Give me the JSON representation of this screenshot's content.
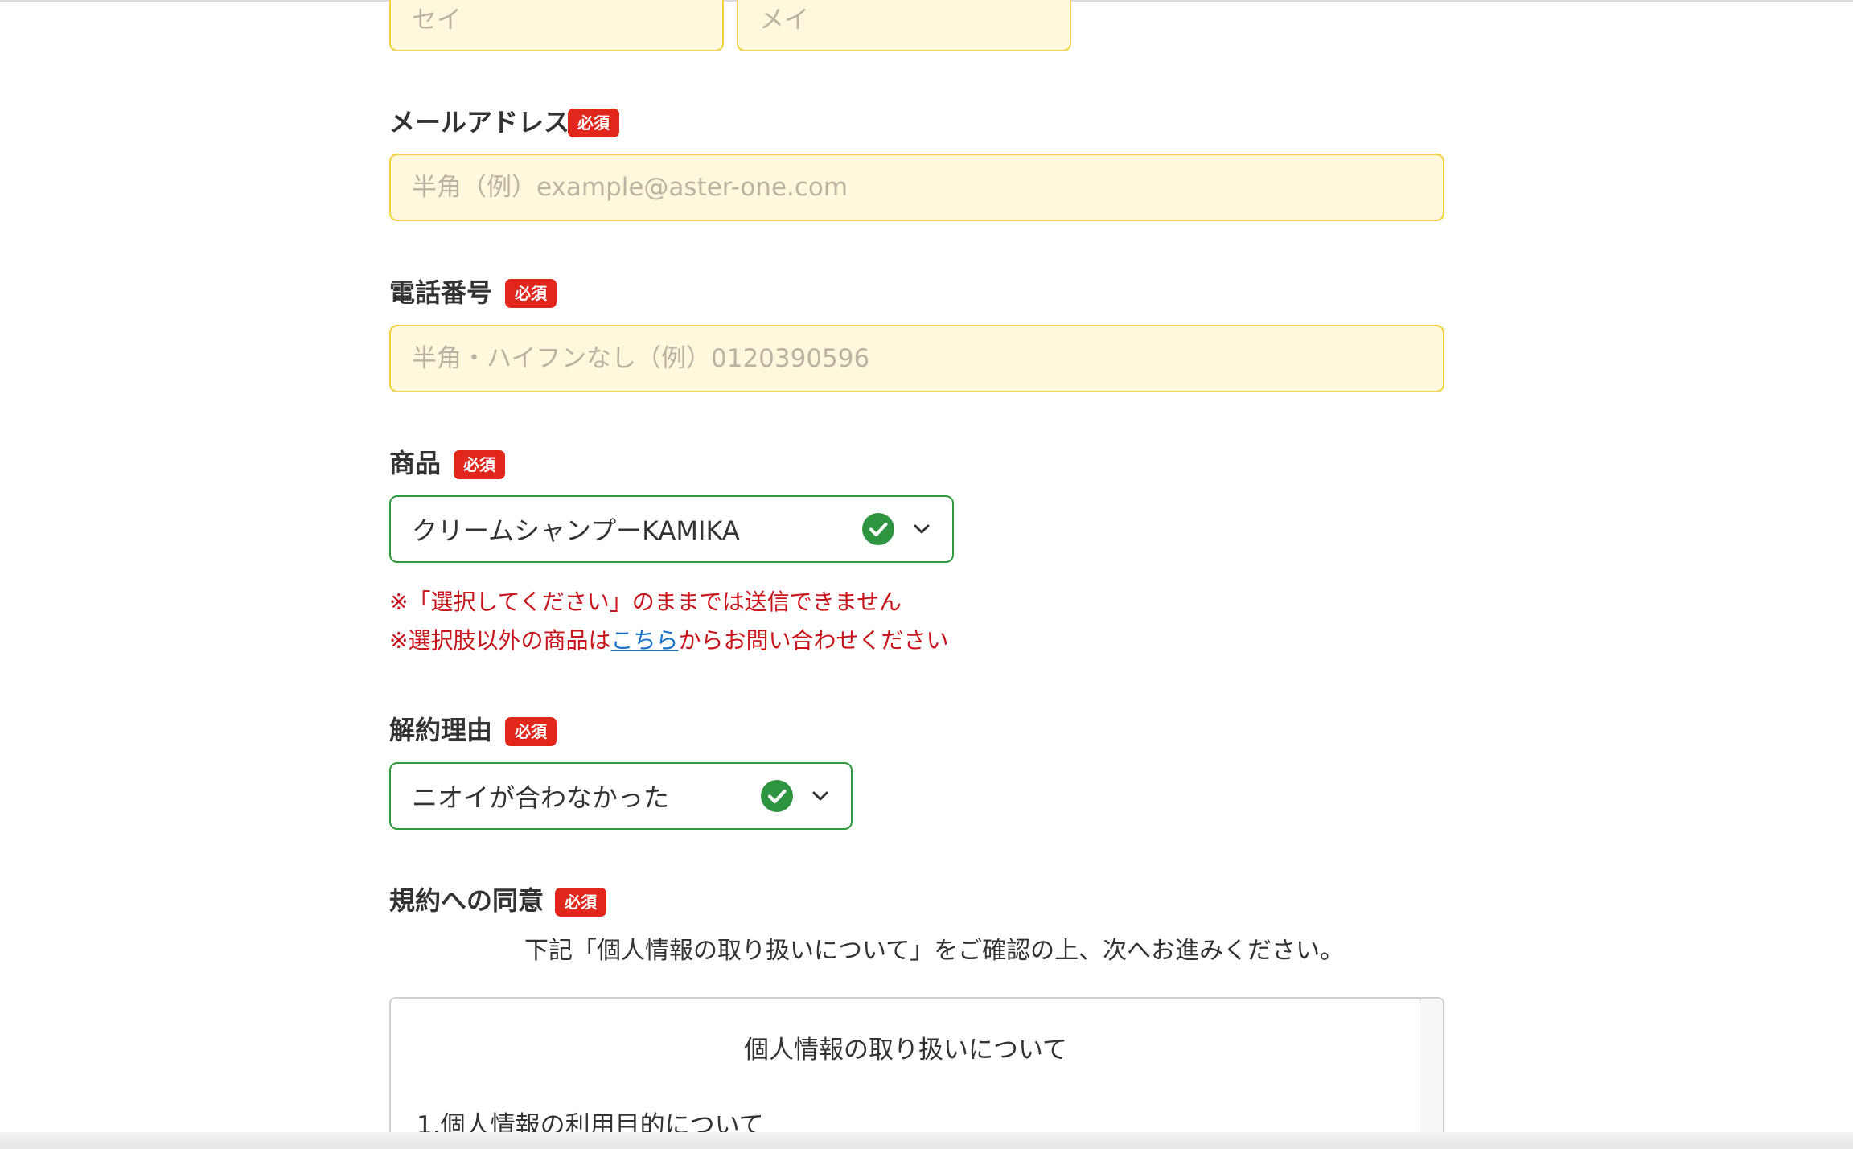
{
  "form": {
    "kana": {
      "sei_placeholder": "セイ",
      "mei_placeholder": "メイ"
    },
    "required_badge": "必須",
    "email": {
      "label": "メールアドレス",
      "placeholder": "半角（例）example@aster-one.com"
    },
    "phone": {
      "label": "電話番号",
      "placeholder": "半角・ハイフンなし（例）0120390596"
    },
    "product": {
      "label": "商品",
      "selected_value": "クリームシャンプーKAMIKA",
      "note1": "※「選択してください」のままでは送信できません",
      "note2_before": "※選択肢以外の商品は",
      "note2_link": "こちら",
      "note2_after": "からお問い合わせください"
    },
    "reason": {
      "label": "解約理由",
      "selected_value": "ニオイが合わなかった"
    },
    "terms": {
      "label": "規約への同意",
      "lead": "下記「個人情報の取り扱いについて」をご確認の上、次へお進みください。",
      "box_title": "個人情報の取り扱いについて",
      "box_item1": "1.個人情報の利用目的について"
    }
  },
  "colors": {
    "input_bg": "#fff8dc",
    "input_border": "#f2d13a",
    "valid_border": "#2f9a3c",
    "check_green": "#2e9440",
    "badge_red": "#e1261c",
    "note_red": "#c8141b",
    "link_blue": "#1a73c8"
  },
  "icons": {
    "valid": "check-circle-icon",
    "dropdown": "chevron-down-icon"
  }
}
